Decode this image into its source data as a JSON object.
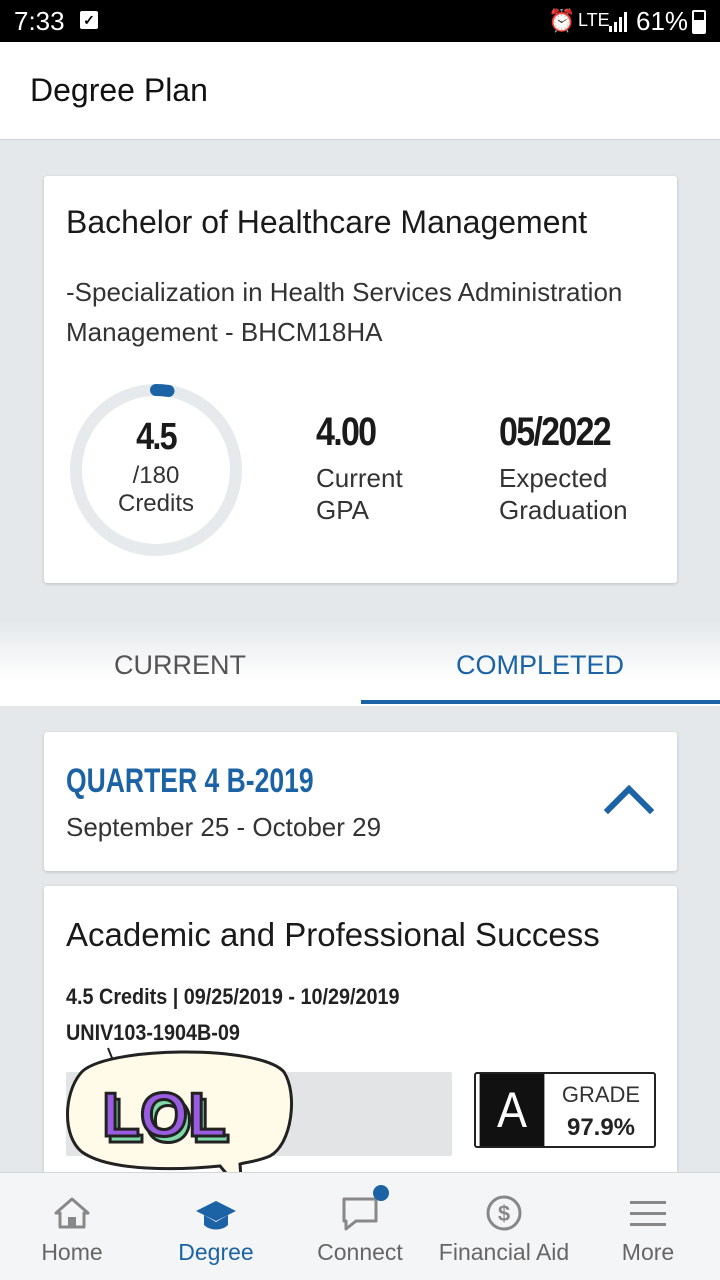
{
  "status_bar": {
    "time": "7:33",
    "network": "LTE",
    "battery": "61%"
  },
  "header": {
    "title": "Degree Plan"
  },
  "program": {
    "name": "Bachelor of Healthcare Management",
    "specialization": "-Specialization in Health Services Administration Management - BHCM18HA",
    "credits_earned": "4.5",
    "credits_total": "/180",
    "credits_label": "Credits",
    "credits_progress": 0.025,
    "gpa_value": "4.00",
    "gpa_label": "Current GPA",
    "graduation_value": "05/2022",
    "graduation_label": "Expected Graduation"
  },
  "tabs": [
    {
      "label": "CURRENT",
      "active": false
    },
    {
      "label": "COMPLETED",
      "active": true
    }
  ],
  "quarter": {
    "title": "QUARTER 4 B-2019",
    "dates": "September 25 - October 29",
    "expanded": true
  },
  "course": {
    "title": "Academic and Professional Success",
    "meta": "4.5 Credits | 09/25/2019 - 10/29/2019",
    "code": "UNIV103-1904B-09",
    "grade_letter": "A",
    "grade_label": "GRADE",
    "grade_value": "97.9%"
  },
  "sticker": {
    "text": "LOL"
  },
  "bottom_nav": [
    {
      "label": "Home",
      "icon": "home-icon"
    },
    {
      "label": "Degree",
      "icon": "graduation-cap-icon",
      "active": true
    },
    {
      "label": "Connect",
      "icon": "chat-icon",
      "badge": true
    },
    {
      "label": "Financial Aid",
      "icon": "dollar-icon"
    },
    {
      "label": "More",
      "icon": "menu-icon"
    }
  ],
  "colors": {
    "accent": "#1b63a5",
    "background": "#e4e8ea",
    "ring_track": "#e6eaec"
  }
}
